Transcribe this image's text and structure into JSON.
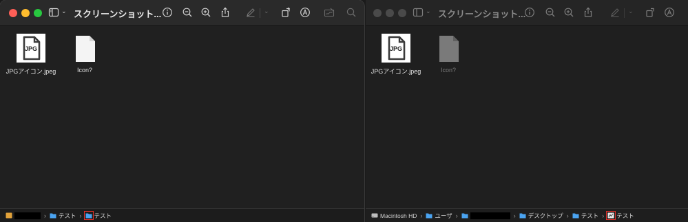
{
  "left_window": {
    "title": "スクリーンショット...",
    "files": [
      {
        "name": "JPGアイコン.jpeg",
        "thumb_label": "JPG",
        "icon": "jpeg-file-icon"
      },
      {
        "name": "Icon?",
        "icon": "blank-document-icon"
      }
    ],
    "path": {
      "segments": [
        {
          "label": "",
          "icon": "redacted-user-folder",
          "redacted": true
        },
        {
          "label": "テスト",
          "icon": "folder-icon"
        },
        {
          "label": "テスト",
          "icon": "folder-icon",
          "highlighted": true
        }
      ]
    }
  },
  "right_window": {
    "title": "スクリーンショット...",
    "files": [
      {
        "name": "JPGアイコン.jpeg",
        "thumb_label": "JPG",
        "icon": "jpeg-file-icon"
      },
      {
        "name": "Icon?",
        "icon": "blank-document-icon",
        "dimmed": true
      }
    ],
    "path": {
      "segments": [
        {
          "label": "Macintosh HD",
          "icon": "disk-icon"
        },
        {
          "label": "ユーザ",
          "icon": "folder-icon"
        },
        {
          "label": "",
          "icon": "folder-icon",
          "redacted": true
        },
        {
          "label": "デスクトップ",
          "icon": "folder-icon"
        },
        {
          "label": "テスト",
          "icon": "folder-icon"
        },
        {
          "label": "テスト",
          "icon": "custom-folder-icon",
          "highlighted": true
        }
      ]
    }
  },
  "colors": {
    "close": "#fe5f57",
    "minimize": "#febc2e",
    "zoom": "#28c840",
    "folder": "#4aa3f0",
    "highlight": "#e0302a"
  }
}
